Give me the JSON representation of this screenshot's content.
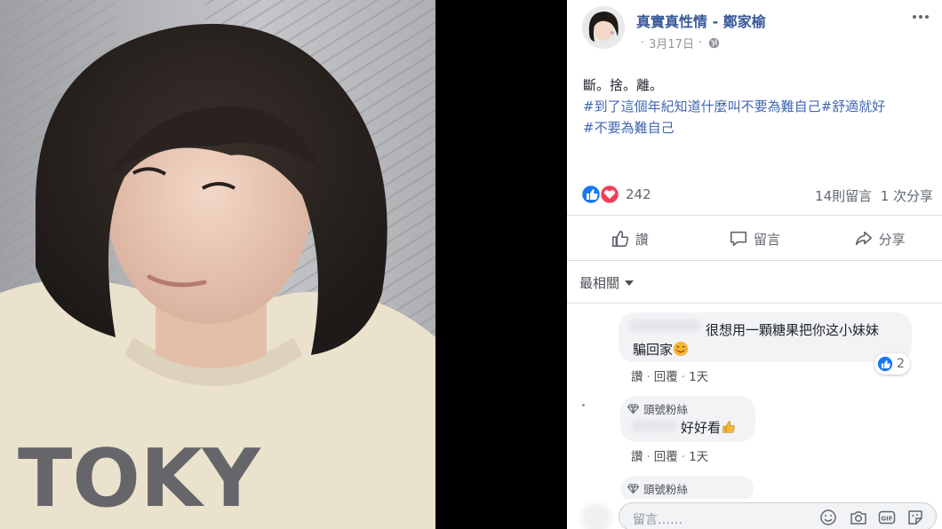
{
  "post": {
    "page_name": "真實真性情 - 鄭家榆",
    "date": "3月17日",
    "text_line1": "斷。捨。離。",
    "hashtags_line1": "#到了這個年紀知道什麼叫不要為難自己#舒適就好",
    "hashtags_line2": "#不要為難自己"
  },
  "reactions": {
    "count": "242",
    "comments": "14則留言",
    "shares": "1 次分享"
  },
  "actions": {
    "like": "讚",
    "comment": "留言",
    "share": "分享"
  },
  "sort_label": "最相關",
  "comments": [
    {
      "line1": "很想用一顆糖果把你这小妹妹",
      "line2": "騙回家",
      "reaction_count": "2",
      "like": "讚",
      "reply": "回覆",
      "time": "1天"
    },
    {
      "badge": "頭號粉絲",
      "text": "好好看",
      "like": "讚",
      "reply": "回覆",
      "time": "1天"
    },
    {
      "badge": "頭號粉絲"
    }
  ],
  "composer": {
    "placeholder": "留言……"
  },
  "icons": {
    "more": "more-options-icon",
    "privacy": "globe-icon",
    "like": "thumbs-up-icon",
    "comment": "speech-bubble-icon",
    "share": "share-arrow-icon",
    "fan": "diamond-icon",
    "emoji": "smiley-icon",
    "camera": "camera-icon",
    "gif": "gif-icon",
    "sticker": "sticker-icon"
  },
  "colors": {
    "link_blue": "#385898",
    "hashtag_blue": "#4267b2",
    "like_blue": "#1877f2",
    "love_red": "#f33e58"
  }
}
